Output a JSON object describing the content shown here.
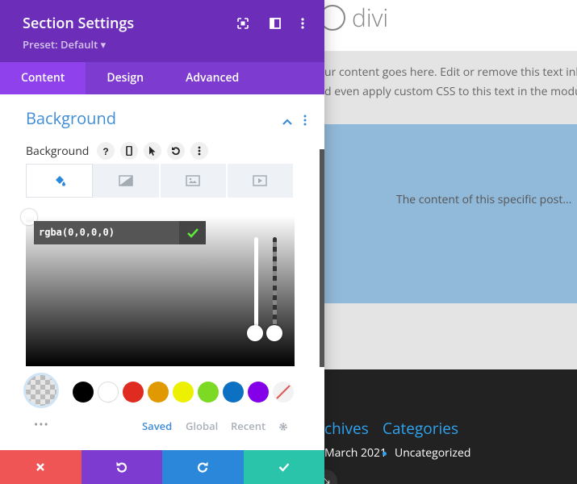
{
  "site": {
    "logo_text": "divi",
    "body_line_1": "ur content goes here. Edit or remove this text inl",
    "body_line_2": "d even apply custom CSS to this text in the modu",
    "blue_text": "The content of this specific post...",
    "footer_headings": [
      "chives",
      "Categories"
    ],
    "footer_items": [
      "March 2021",
      "Uncategorized"
    ],
    "colors": {
      "link": "#2ea3f2",
      "footer_bg": "#222222",
      "hero_bg": "#91b9d9"
    }
  },
  "panel": {
    "title": "Section Settings",
    "preset": "Preset: Default ▾",
    "header_icons": [
      "fullscreen-icon",
      "sidebar-toggle-icon",
      "more-vertical-icon"
    ],
    "tabs": [
      {
        "label": "Content",
        "active": true
      },
      {
        "label": "Design",
        "active": false
      },
      {
        "label": "Advanced",
        "active": false
      }
    ],
    "section_title": "Background",
    "option_label": "Background",
    "option_tools": [
      "help-icon",
      "mobile-icon",
      "cursor-icon",
      "reset-icon",
      "more-vertical-icon"
    ],
    "bg_types": [
      {
        "icon": "paint-bucket-icon",
        "active": true
      },
      {
        "icon": "gradient-icon",
        "active": false
      },
      {
        "icon": "image-icon",
        "active": false
      },
      {
        "icon": "video-icon",
        "active": false
      }
    ],
    "color_value": "rgba(0,0,0,0)",
    "swatches": [
      "#000000",
      "#ffffff",
      "#e02b20",
      "#e09900",
      "#edf000",
      "#7cda24",
      "#0c71c3",
      "#8300e9",
      "none"
    ],
    "palette_links": [
      {
        "label": "Saved",
        "active": true
      },
      {
        "label": "Global",
        "active": false
      },
      {
        "label": "Recent",
        "active": false
      }
    ],
    "footer_buttons": [
      {
        "icon": "close-icon",
        "color": "#ef5555"
      },
      {
        "icon": "undo-icon",
        "color": "#7e3bd0"
      },
      {
        "icon": "redo-icon",
        "color": "#2b87da"
      },
      {
        "icon": "check-icon",
        "color": "#29c4a9"
      }
    ],
    "colors": {
      "header": "#6c2eb9",
      "tabs": "#7d3bcf",
      "tab_active": "#8f42ec",
      "accent": "#3e8cd6"
    }
  }
}
